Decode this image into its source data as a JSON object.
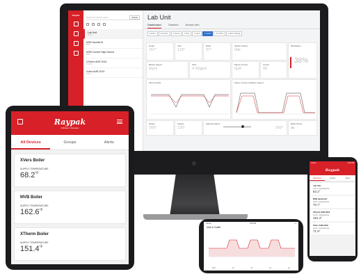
{
  "desktop": {
    "search_placeholder": "Search by device name",
    "status_button": "Status",
    "sidebar_items": [
      {
        "name": "Lab Unit",
        "sub": "XVers"
      },
      {
        "name": "MVB Jacinta Dr",
        "sub": "MVB"
      },
      {
        "name": "MVB Current High School",
        "sub": "MVB"
      },
      {
        "name": "XTherm AHR 2019",
        "sub": "XTherm"
      },
      {
        "name": "XVers AHR 2019",
        "sub": "XVers"
      }
    ],
    "title": "Lab Unit",
    "tabs": [
      "Dashboard",
      "Timeline",
      "Device Info"
    ],
    "active_tab": "Dashboard",
    "ranges": [
      "Current",
      "Last Hour",
      "4 Hours",
      "1 Day",
      "1 week",
      "1 month",
      "3 months",
      "Custom Range"
    ],
    "active_range": "1 month",
    "cards": {
      "outlet": {
        "label": "Outlet",
        "value": "157°"
      },
      "inlet": {
        "label": "Inlet",
        "value": "119°"
      },
      "delta": {
        "label": "Delta",
        "value": "37°"
      },
      "ignition": {
        "label": "Ignition Status",
        "value": "Idle"
      },
      "modulation": {
        "label": "Modulation",
        "value": "38%"
      },
      "blower": {
        "label": "Blower Speed",
        "value": "0rpm"
      },
      "flow": {
        "label": "Flow",
        "value": "4.50gpm"
      },
      "flame": {
        "label": "Flame Current",
        "value": "0µA"
      },
      "cycles": {
        "label": "Cycles",
        "value": "58"
      },
      "inlet_outlet": {
        "label": "Inlet & Outlet"
      },
      "flame_blower": {
        "label": "Flame Current & Blower Speed"
      },
      "target": {
        "label": "Target",
        "value": "160°"
      },
      "supply": {
        "label": "Supply",
        "value": "120°"
      },
      "setpoint": {
        "label": "Setpoint Adjust",
        "value": "160°"
      },
      "pump": {
        "label": "Boiler Pump",
        "value": "On"
      }
    }
  },
  "tablet": {
    "brand": "Raypak",
    "brand_sub": "A Rheem Company",
    "tabs": [
      "All Devices",
      "Groups",
      "Alerts"
    ],
    "active_tab": "All Devices",
    "cards": [
      {
        "name": "XVers Boiler",
        "label": "SUPPLY TEMPERATURE",
        "value": "68.2",
        "unit": "°F"
      },
      {
        "name": "MVB Boiler",
        "label": "SUPPLY TEMPERATURE",
        "value": "162.6",
        "unit": "°F"
      },
      {
        "name": "XTherm Boiler",
        "label": "SUPPLY TEMPERATURE",
        "value": "151.4",
        "unit": "°F"
      }
    ]
  },
  "phone": {
    "carrier": "Carrier",
    "time": "5:09 PM",
    "brand": "Raypak",
    "tabs": [
      "All Devices",
      "Groups",
      "Alerts"
    ],
    "active_tab": "All Devices",
    "cards": [
      {
        "name": "Lab Unit",
        "label": "SUPPLY TEMPERATURE",
        "value": "82.2°"
      },
      {
        "name": "MVB Jacinta Dr",
        "label": "SUPPLY TEMPERATURE",
        "value": "70.7°"
      },
      {
        "name": "XTherm AHR 2019",
        "label": "SUPPLY TEMPERATURE",
        "value": "151.4°"
      },
      {
        "name": "XVers AHR 2019",
        "label": "SUPPLY TEMPERATURE",
        "value": "71.9°"
      }
    ]
  },
  "phone_landscape": {
    "status_left": "Carrier",
    "time": "8:55 AM",
    "title": "Inlet & Outlet",
    "footer": [
      "Now",
      "1h",
      "4h",
      "1d",
      "1w"
    ]
  },
  "colors": {
    "brand_red": "#d72027",
    "range_blue": "#2f6fc9"
  }
}
